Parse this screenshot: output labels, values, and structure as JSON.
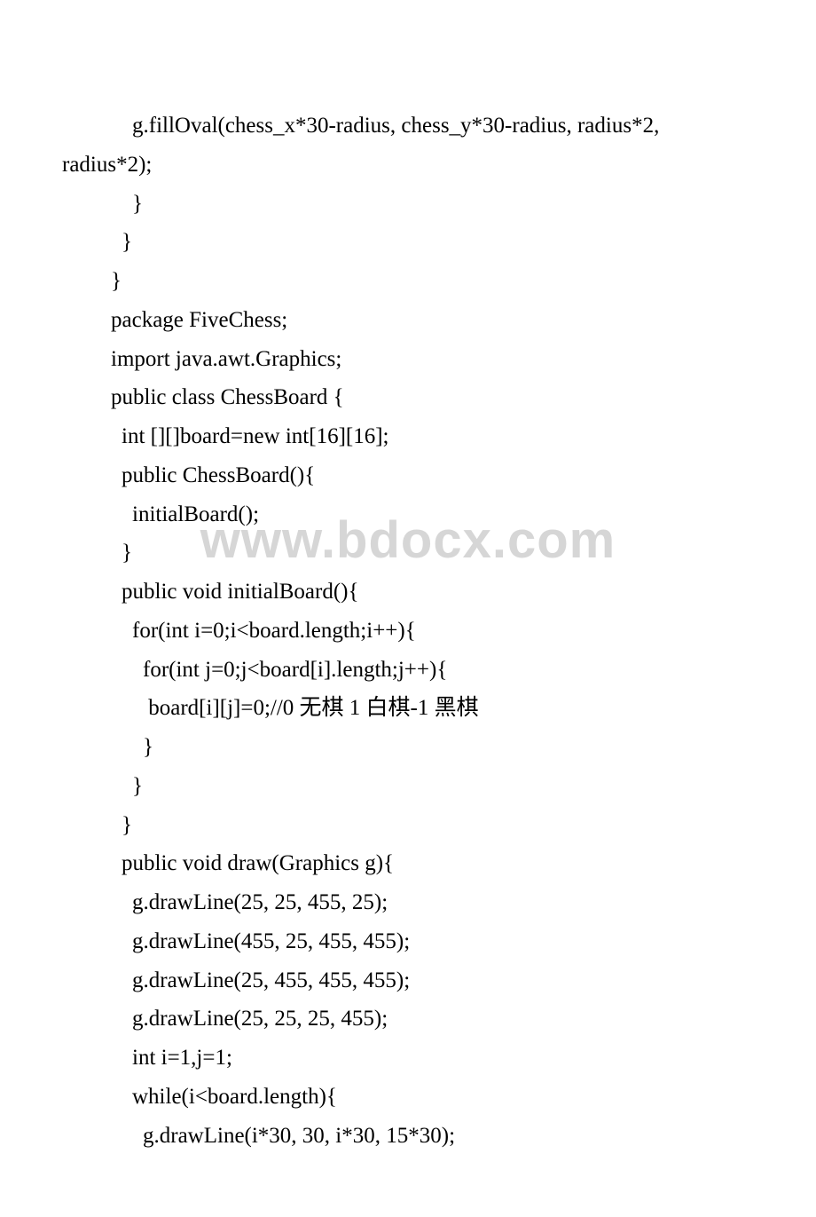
{
  "watermark": "www.bdocx.com",
  "lines": [
    {
      "indent": 3,
      "text": "g.fillOval(chess_x*30-radius, chess_y*30-radius, radius*2, "
    },
    {
      "indent": 0,
      "text": "radius*2);"
    },
    {
      "indent": 3,
      "text": "}"
    },
    {
      "indent": 2,
      "text": "}"
    },
    {
      "indent": 1,
      "text": "}"
    },
    {
      "indent": 1,
      "text": "package FiveChess;"
    },
    {
      "indent": 1,
      "text": "import java.awt.Graphics;"
    },
    {
      "indent": 1,
      "text": "public class ChessBoard {"
    },
    {
      "indent": 2,
      "text": "int [][]board=new int[16][16];"
    },
    {
      "indent": 2,
      "text": "public ChessBoard(){"
    },
    {
      "indent": 3,
      "text": "initialBoard();"
    },
    {
      "indent": 2,
      "text": "}"
    },
    {
      "indent": 2,
      "text": "public void initialBoard(){"
    },
    {
      "indent": 3,
      "text": "for(int i=0;i<board.length;i++){"
    },
    {
      "indent": 4,
      "text": "for(int j=0;j<board[i].length;j++){"
    },
    {
      "indent": 4,
      "text": " board[i][j]=0;//0 无棋 1 白棋-1 黑棋"
    },
    {
      "indent": 4,
      "text": "}"
    },
    {
      "indent": 3,
      "text": "}"
    },
    {
      "indent": 2,
      "text": "}"
    },
    {
      "indent": 2,
      "text": "public void draw(Graphics g){"
    },
    {
      "indent": 3,
      "text": "g.drawLine(25, 25, 455, 25);"
    },
    {
      "indent": 3,
      "text": "g.drawLine(455, 25, 455, 455);"
    },
    {
      "indent": 3,
      "text": "g.drawLine(25, 455, 455, 455);"
    },
    {
      "indent": 3,
      "text": "g.drawLine(25, 25, 25, 455);"
    },
    {
      "indent": 3,
      "text": "int i=1,j=1;"
    },
    {
      "indent": 3,
      "text": "while(i<board.length){"
    },
    {
      "indent": 4,
      "text": "g.drawLine(i*30, 30, i*30, 15*30);"
    }
  ]
}
